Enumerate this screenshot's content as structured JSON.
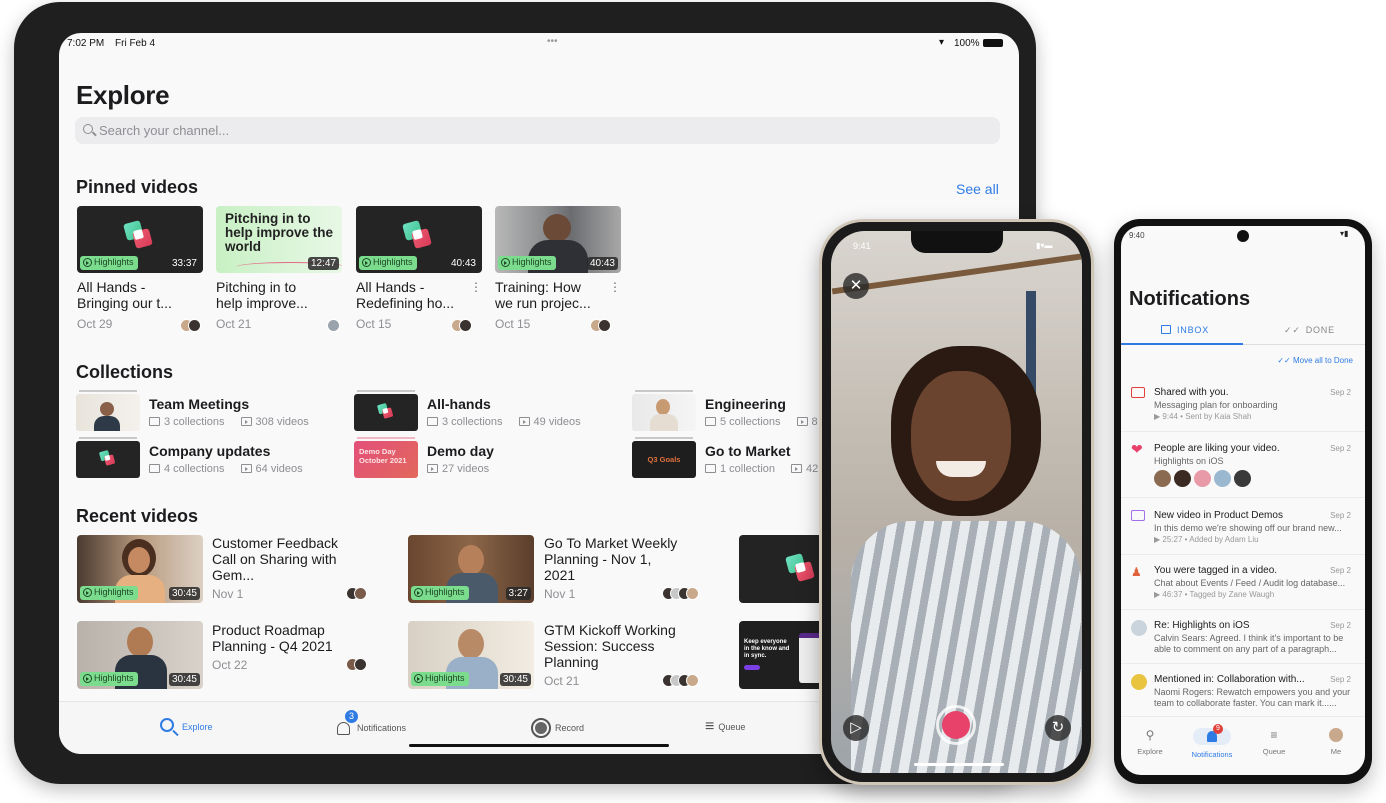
{
  "ipad": {
    "status": {
      "time": "7:02 PM",
      "date": "Fri Feb 4",
      "dots": "•••",
      "battery": "100%"
    },
    "title": "Explore",
    "search": {
      "placeholder": "Search your channel..."
    },
    "pinned": {
      "heading": "Pinned videos",
      "see_all": "See all",
      "items": [
        {
          "title_l1": "All Hands -",
          "title_l2": "Bringing our t...",
          "date": "Oct 29",
          "badge": "Highlights",
          "duration": "33:37"
        },
        {
          "title_l1": "Pitching in to",
          "title_l2": "help improve...",
          "date": "Oct 21",
          "badge": "",
          "duration": "12:47",
          "thumb_text": "Pitching in to help improve the world"
        },
        {
          "title_l1": "All Hands -",
          "title_l2": "Redefining ho...",
          "date": "Oct 15",
          "badge": "Highlights",
          "duration": "40:43"
        },
        {
          "title_l1": "Training: How",
          "title_l2": "we run projec...",
          "date": "Oct 15",
          "badge": "Highlights",
          "duration": "40:43"
        }
      ]
    },
    "collections": {
      "heading": "Collections",
      "items": [
        {
          "name": "Team Meetings",
          "collections": "3 collections",
          "videos": "308 videos"
        },
        {
          "name": "All-hands",
          "collections": "3 collections",
          "videos": "49 videos"
        },
        {
          "name": "Engineering",
          "collections": "5 collections",
          "videos": "8"
        },
        {
          "name": "Company updates",
          "collections": "4 collections",
          "videos": "64 videos"
        },
        {
          "name": "Demo day",
          "collections": "",
          "videos": "27 videos",
          "thumb_text": "Demo Day October 2021"
        },
        {
          "name": "Go to Market",
          "collections": "1 collection",
          "videos": "42",
          "thumb_text": "Q3 Goals"
        }
      ]
    },
    "recent": {
      "heading": "Recent videos",
      "items": [
        {
          "title": "Customer Feedback Call on Sharing with Gem...",
          "date": "Nov 1",
          "badge": "Highlights",
          "duration": "30:45"
        },
        {
          "title": "Go To Market Weekly Planning - Nov 1, 2021",
          "date": "Nov 1",
          "badge": "Highlights",
          "duration": "3:27"
        },
        {
          "title": "Product Roadmap Planning - Q4 2021",
          "date": "Oct 22",
          "badge": "Highlights",
          "duration": "30:45"
        },
        {
          "title": "GTM Kickoff Working Session: Success Planning",
          "date": "Oct 21",
          "badge": "Highlights",
          "duration": "30:45"
        }
      ],
      "promo_text": "Keep everyone in the know and in sync."
    },
    "tabbar": {
      "explore": "Explore",
      "notifications": "Notifications",
      "notifications_badge": "3",
      "record": "Record",
      "queue": "Queue"
    }
  },
  "iphone": {
    "time": "9:41",
    "close": "✕"
  },
  "android": {
    "time": "9:40",
    "title": "Notifications",
    "tabs": {
      "inbox": "INBOX",
      "done": "DONE"
    },
    "move_all": "Move all to Done",
    "items": [
      {
        "heading": "Shared with you.",
        "body": "Messaging plan for onboarding",
        "meta": "▶ 9:44 • Sent by Kaia Shah",
        "date": "Sep 2"
      },
      {
        "heading": "People are liking your video.",
        "body": "Highlights on iOS",
        "meta": "",
        "date": "Sep 2"
      },
      {
        "heading": "New video in Product Demos",
        "body": "In this demo we're showing off our brand new...",
        "meta": "▶ 25:27 • Added by Adam Liu",
        "date": "Sep 2"
      },
      {
        "heading": "You were tagged in a video.",
        "body": "Chat about Events / Feed / Audit log database...",
        "meta": "▶ 46:37 • Tagged by Zane Waugh",
        "date": "Sep 2"
      },
      {
        "heading": "Re: Highlights on iOS",
        "body": "Calvin Sears: Agreed. I think it's important to be able to comment on any part of a paragraph...",
        "meta": "",
        "date": "Sep 2"
      },
      {
        "heading": "Mentioned in: Collaboration with...",
        "body": "Naomi Rogers: Rewatch empowers you and your team to collaborate faster. You can mark it......",
        "meta": "",
        "date": "Sep 2"
      }
    ],
    "nav": {
      "explore": "Explore",
      "notifications": "Notifications",
      "notifications_badge": "9",
      "queue": "Queue",
      "me": "Me"
    }
  },
  "colors": {
    "accent": "#2f7be4",
    "highlight": "#7bdc8e",
    "record": "#e8416a"
  }
}
